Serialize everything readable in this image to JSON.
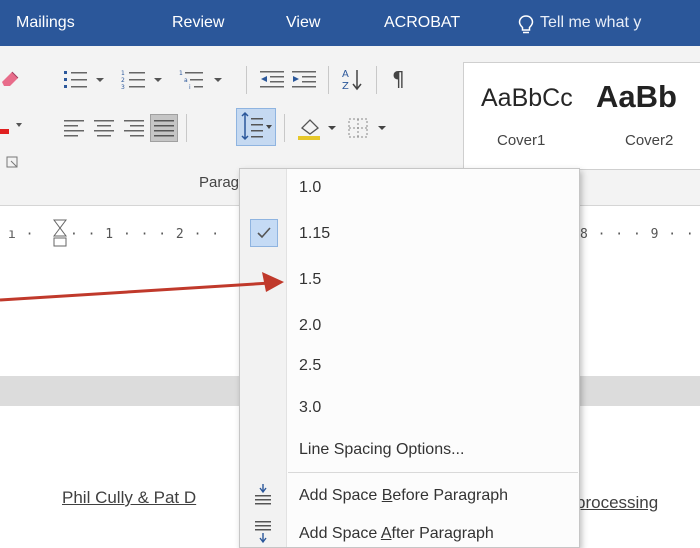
{
  "tabs": [
    {
      "label": "Mailings"
    },
    {
      "label": "Review"
    },
    {
      "label": "View"
    },
    {
      "label": "ACROBAT"
    }
  ],
  "tell_me": {
    "text": "Tell me what y",
    "icon": "lightbulb-icon"
  },
  "paragraph_group": {
    "label": "Parag"
  },
  "styles": {
    "items": [
      {
        "sample": "AaBbCc",
        "name": "Cover1"
      },
      {
        "sample": "AaBb",
        "name": "Cover2"
      }
    ]
  },
  "ruler": {
    "left_ticks": "· · 1 · · · 2 · ·",
    "right_ticks": "8 · · · 9 · ·"
  },
  "document": {
    "left_text": "Phil Cully & Pat D",
    "right_text": "processing"
  },
  "line_spacing_menu": {
    "options": [
      {
        "value": "1.0",
        "checked": false
      },
      {
        "value": "1.15",
        "checked": true
      },
      {
        "value": "1.5",
        "checked": false
      },
      {
        "value": "2.0",
        "checked": false
      },
      {
        "value": "2.5",
        "checked": false
      },
      {
        "value": "3.0",
        "checked": false
      }
    ],
    "options_label": "Line Spacing Options...",
    "add_before": {
      "pre": "Add Space ",
      "key": "B",
      "post": "efore Paragraph"
    },
    "add_after": {
      "pre": "Add Space ",
      "key": "A",
      "post": "fter Paragraph"
    }
  },
  "colors": {
    "ribbon_tab": "#2b579a",
    "arrow": "#c0392b",
    "checked_bg": "#c5dbf5"
  }
}
